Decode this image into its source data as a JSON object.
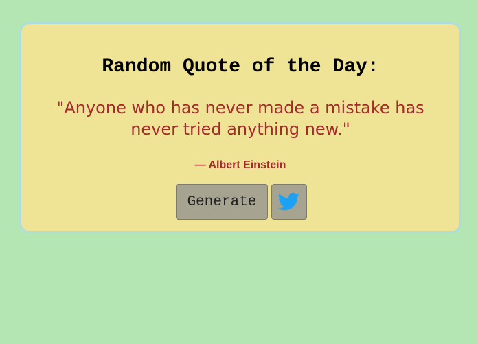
{
  "card": {
    "title": "Random Quote of the Day:",
    "quote": "\"Anyone who has never made a mistake has never tried anything new.\"",
    "author": "— Albert Einstein"
  },
  "buttons": {
    "generate_label": "Generate",
    "tweet_icon": "twitter-icon"
  },
  "colors": {
    "background": "#b3e6b3",
    "card": "#efe496",
    "card_border": "#aedde0",
    "quote_text": "#a52a2a",
    "button": "#a6a391",
    "twitter_blue": "#1da1f2"
  }
}
